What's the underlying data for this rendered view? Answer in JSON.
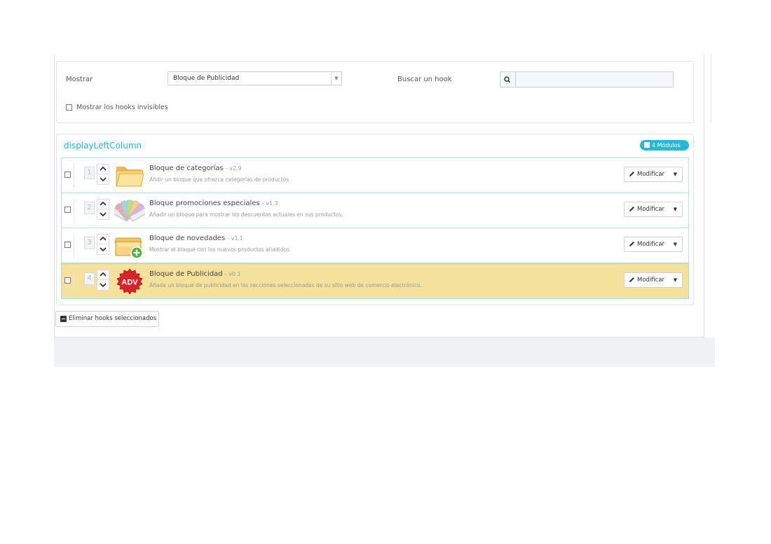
{
  "filters": {
    "show_label": "Mostrar",
    "show_selected": "Bloque de Publicidad",
    "search_label": "Buscar un hook",
    "search_value": "",
    "invisible_hooks_label": "Mostrar los hooks invisibles"
  },
  "hook": {
    "name": "displayLeftColumn",
    "badge": "4 Módulos",
    "modules": [
      {
        "position": "1",
        "name": "Bloque de categorías",
        "version": "- v2.9",
        "description": "Añdir un bloque que ofrezca categorías de productos",
        "icon": "folder-icon",
        "highlighted": false,
        "edit_label": "Modificar"
      },
      {
        "position": "2",
        "name": "Bloque promociones especiales",
        "version": "- v1.3",
        "description": "Añadir un bloque para mostrar los descuentos actuales en sus productos.",
        "icon": "swatches-icon",
        "highlighted": false,
        "edit_label": "Modificar"
      },
      {
        "position": "3",
        "name": "Bloque de novedades",
        "version": "- v1.1",
        "description": "Mostrar el bloque con los nuevos productos añadidos",
        "icon": "new-box-icon",
        "highlighted": false,
        "edit_label": "Modificar"
      },
      {
        "position": "4",
        "name": "Bloque de Publicidad",
        "version": "- v0.1",
        "description": "Añade un bloque de publicidad en las secciones seleccionadas de su sitio web de comercio electrónico.",
        "icon": "adv-badge-icon",
        "icon_text": "ADV",
        "highlighted": true,
        "edit_label": "Modificar"
      }
    ]
  },
  "actions": {
    "delete_selected_label": "Eliminar hooks seleccionados"
  },
  "colors": {
    "accent": "#25b9d7",
    "highlight_row": "#f4e19c",
    "row_border": "#b9e0ea"
  }
}
